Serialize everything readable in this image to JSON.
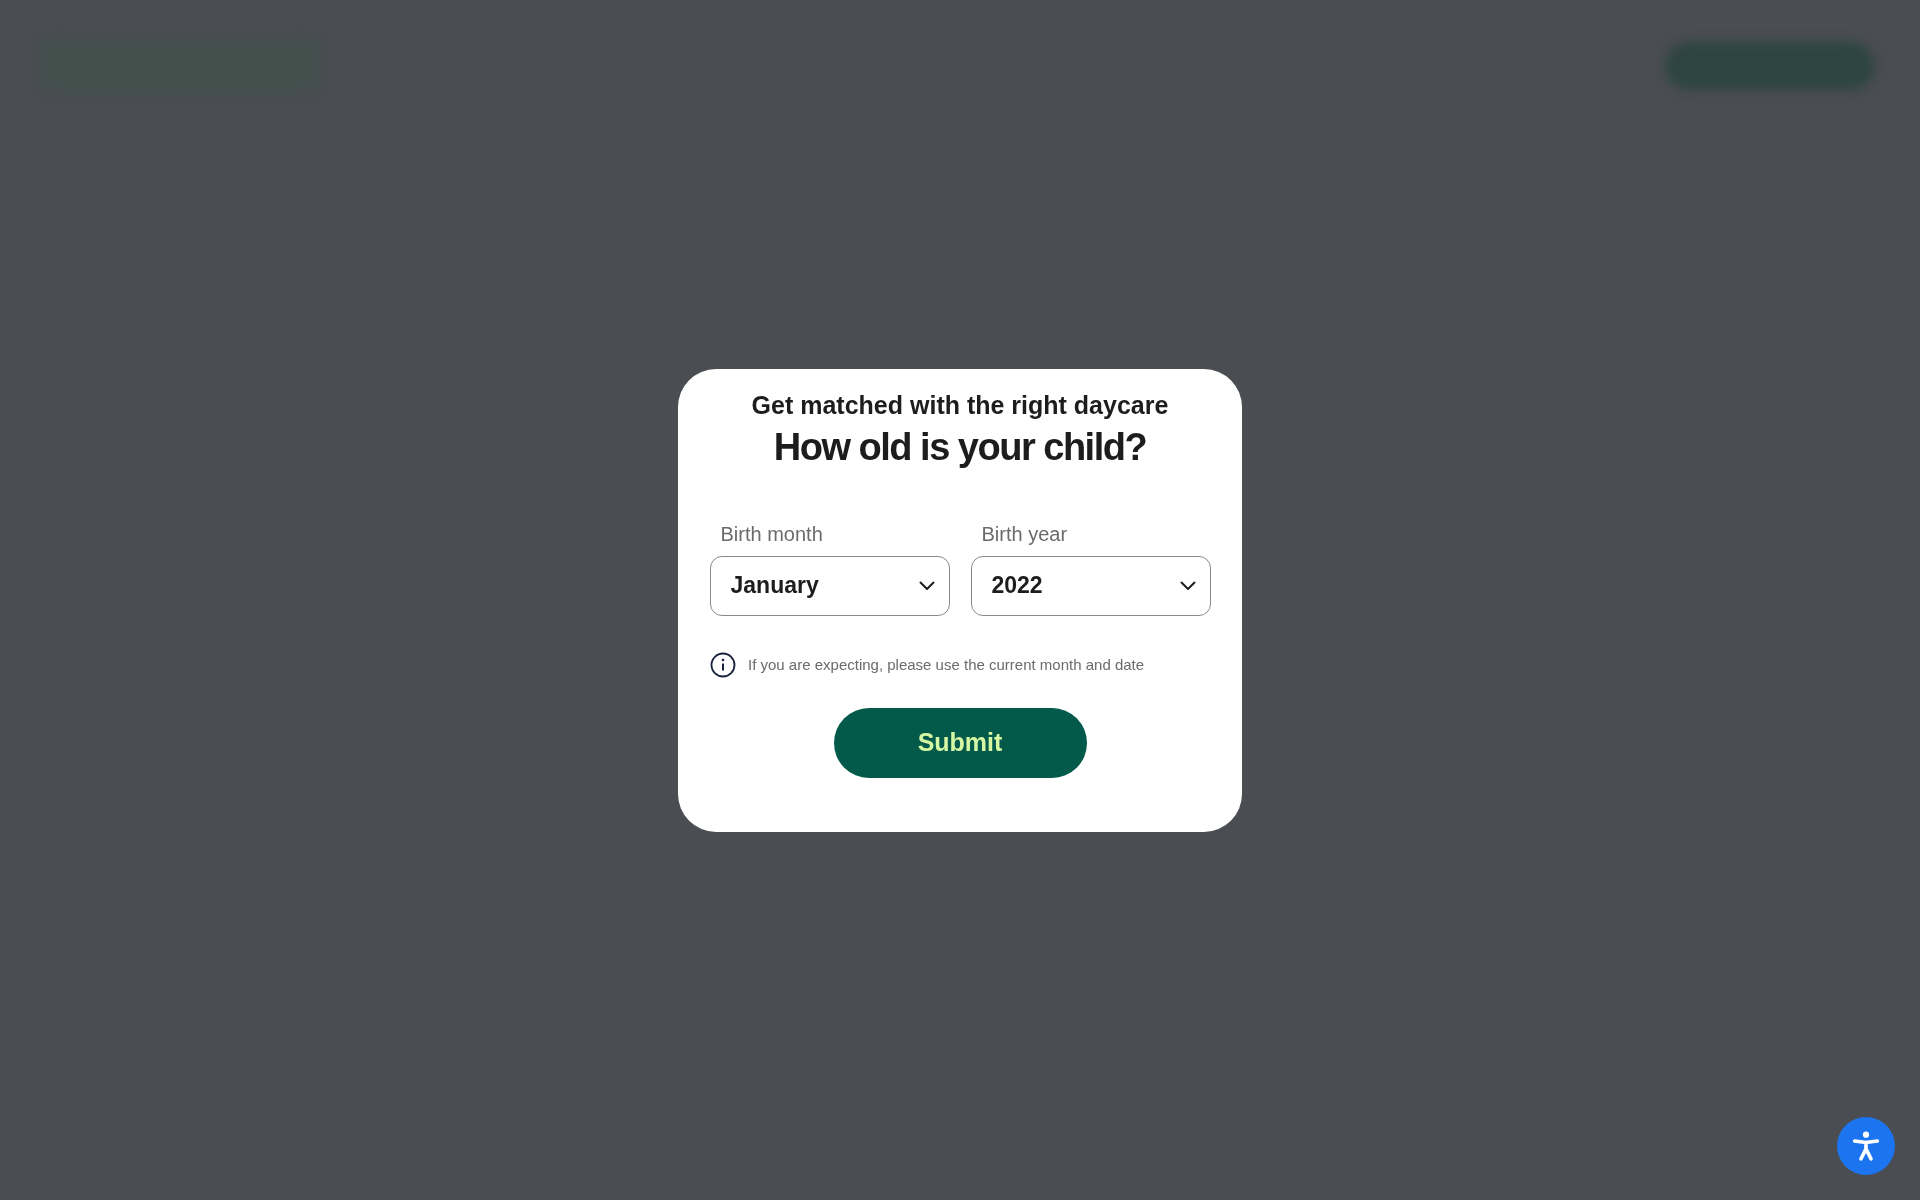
{
  "modal": {
    "subtitle": "Get matched with the right daycare",
    "title": "How old is your child?",
    "fields": [
      {
        "label": "Birth month",
        "value": "January"
      },
      {
        "label": "Birth year",
        "value": "2022"
      }
    ],
    "note": "If you are expecting, please use the current month and date",
    "submit": "Submit"
  }
}
